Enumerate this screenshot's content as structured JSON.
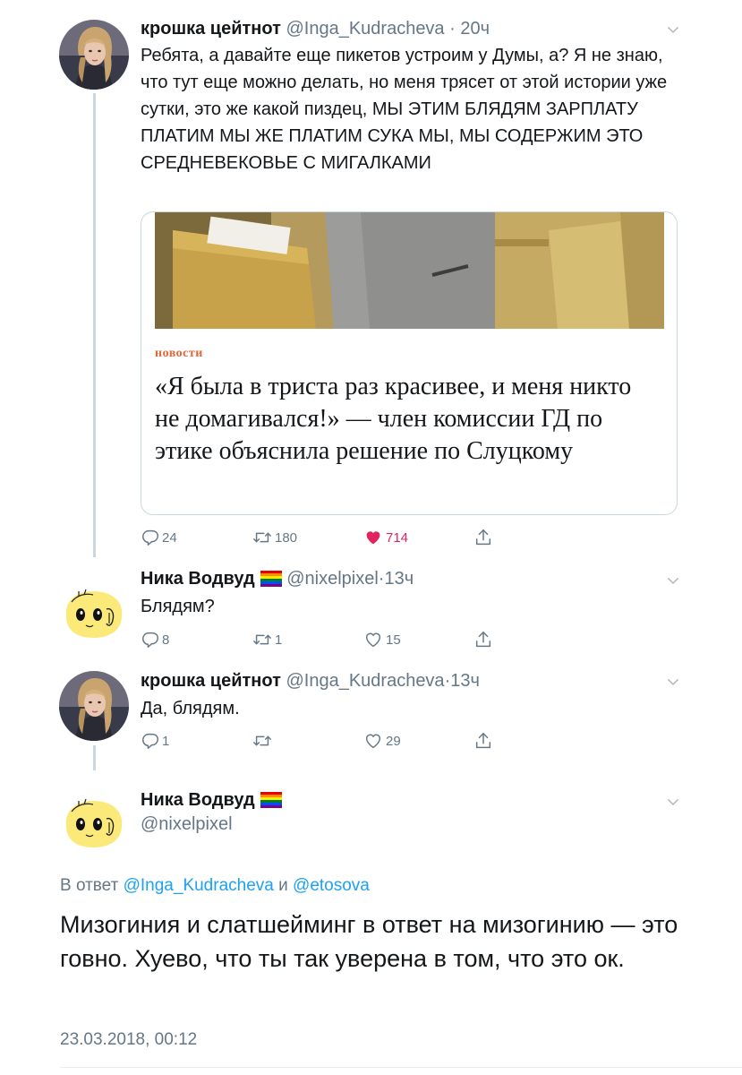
{
  "tweets": [
    {
      "name": "крошка цейтнот",
      "handle": "@Inga_Kudracheva",
      "sep": "·",
      "time": "20ч",
      "text": "Ребята, а давайте еще пикетов устроим у Думы, а? Я не знаю, что тут еще можно делать, но меня трясет от этой истории уже сутки, это же какой пиздец, МЫ ЭТИМ БЛЯДЯМ ЗАРПЛАТУ ПЛАТИМ МЫ ЖЕ ПЛАТИМ СУКА МЫ, МЫ СОДЕРЖИМ ЭТО СРЕДНЕВЕКОВЬЕ С МИГАЛКАМИ",
      "card": {
        "kicker": "новости",
        "title": "«Я была в триста раз красивее, и меня никто не домагивался!» — член комиссии ГД по этике объяснила решение по Слуцкому"
      },
      "replies": "24",
      "retweets": "180",
      "likes": "714"
    },
    {
      "name": "Ника Водвуд",
      "handle": "@nixelpixel",
      "sep": "·",
      "time": "13ч",
      "text": "Блядям?",
      "replies": "8",
      "retweets": "1",
      "likes": "15"
    },
    {
      "name": "крошка цейтнот",
      "handle": "@Inga_Kudracheva",
      "sep": "·",
      "time": "13ч",
      "text": "Да, блядям.",
      "replies": "1",
      "retweets": "",
      "likes": "29"
    }
  ],
  "main": {
    "name": "Ника Водвуд",
    "handle": "@nixelpixel",
    "reply_prefix": "В ответ ",
    "mention1": "@Inga_Kudracheva",
    "and": " и ",
    "mention2": "@etosova",
    "text": "Мизогиния и слатшейминг в ответ на мизогинию — это говно. Хуево, что ты так уверена в том, что это ок.",
    "date": "23.03.2018, 00:12"
  },
  "colors": {
    "like_active": "#e0245e",
    "link": "#1da1f2",
    "muted": "#657786",
    "kicker": "#e0683b"
  },
  "icons": [
    "reply-icon",
    "retweet-icon",
    "heart-icon",
    "share-icon",
    "chevron-down-icon",
    "rainbow-flag-icon"
  ]
}
